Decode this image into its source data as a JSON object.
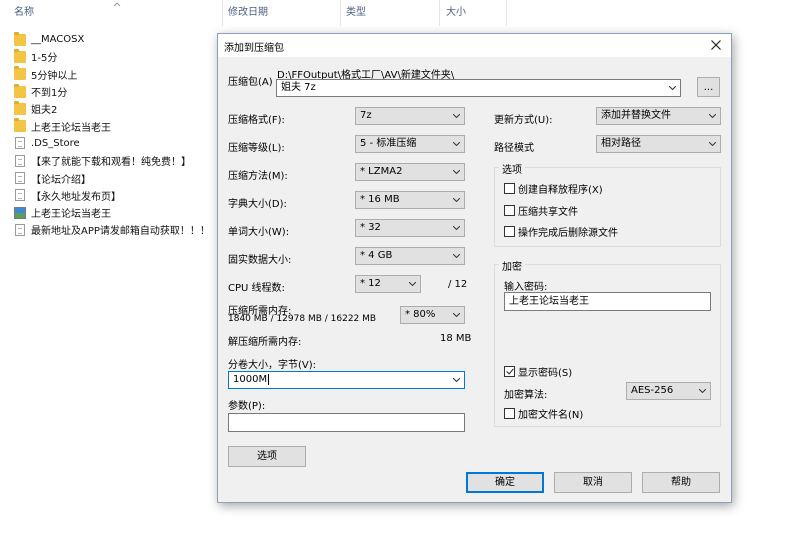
{
  "explorer": {
    "headers": {
      "name": "名称",
      "modified": "修改日期",
      "type": "类型",
      "size": "大小"
    },
    "files": [
      {
        "name": "__MACOSX",
        "icon": "folder-icon"
      },
      {
        "name": "1-5分",
        "icon": "folder-icon"
      },
      {
        "name": "5分钟以上",
        "icon": "folder-icon"
      },
      {
        "name": "不到1分",
        "icon": "folder-icon"
      },
      {
        "name": "姐夫2",
        "icon": "folder-icon"
      },
      {
        "name": "上老王论坛当老王",
        "icon": "folder-icon"
      },
      {
        "name": ".DS_Store",
        "icon": "file-icon"
      },
      {
        "name": "【来了就能下载和观看！纯免费！】",
        "icon": "file-icon"
      },
      {
        "name": "【论坛介绍】",
        "icon": "file-icon"
      },
      {
        "name": "【永久地址发布页】",
        "icon": "file-icon"
      },
      {
        "name": "上老王论坛当老王",
        "icon": "image-file-icon"
      },
      {
        "name": "最新地址及APP请发邮箱自动获取！！！",
        "icon": "file-icon"
      }
    ]
  },
  "dialog": {
    "title": "添加到压缩包",
    "archive_label": "压缩包(A)",
    "archive_path": "D:\\FFOutput\\格式工厂\\AV\\新建文件夹\\",
    "archive_name": "姐夫 7z",
    "browse_label": "...",
    "format_label": "压缩格式(F):",
    "format_value": "7z",
    "level_label": "压缩等级(L):",
    "level_value": "5 - 标准压缩",
    "method_label": "压缩方法(M):",
    "method_value": "* LZMA2",
    "dict_label": "字典大小(D):",
    "dict_value": "* 16 MB",
    "word_label": "单词大小(W):",
    "word_value": "* 32",
    "solid_label": "固实数据大小:",
    "solid_value": "* 4 GB",
    "threads_label": "CPU 线程数:",
    "threads_value": "* 12",
    "threads_total": "/ 12",
    "mem_label": "压缩所需内存:",
    "mem_detail": "1840 MB / 12978 MB / 16222 MB",
    "mem_percent": "* 80%",
    "decomp_label": "解压缩所需内存:",
    "decomp_value": "18 MB",
    "split_label": "分卷大小，字节(V):",
    "split_value": "1000M",
    "params_label": "参数(P):",
    "params_value": "",
    "options_button": "选项",
    "update_label": "更新方式(U):",
    "update_value": "添加并替换文件",
    "path_label": "路径模式",
    "path_value": "相对路径",
    "options_group": "选项",
    "opt_sfx": "创建自释放程序(X)",
    "opt_shared": "压缩共享文件",
    "opt_delete": "操作完成后删除源文件",
    "enc_group": "加密",
    "pw_label": "输入密码:",
    "pw_value": "上老王论坛当老王",
    "show_pw": "显示密码(S)",
    "enc_method_label": "加密算法:",
    "enc_method_value": "AES-256",
    "enc_names": "加密文件名(N)",
    "ok": "确定",
    "cancel": "取消",
    "help": "帮助",
    "checks": {
      "sfx": false,
      "shared": false,
      "delete": false,
      "show_pw": true,
      "enc_names": false
    }
  },
  "colors": {
    "accent": "#0078d7",
    "dialog_bg": "#f0f0f0",
    "folder": "#f3c445"
  }
}
